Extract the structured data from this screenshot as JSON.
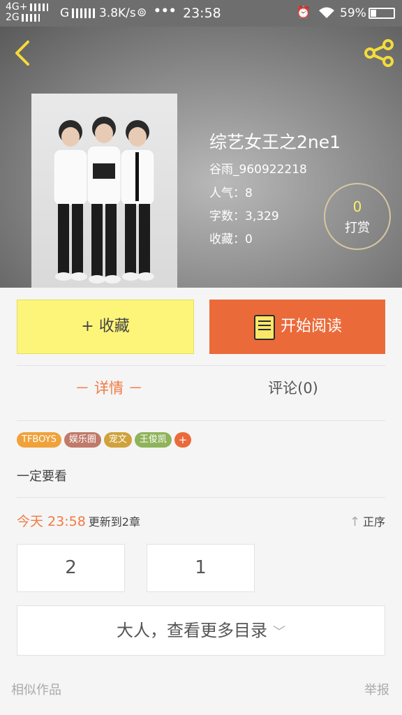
{
  "statusbar": {
    "net1": "4G+",
    "net2": "2G",
    "g": "G",
    "speed": "3.8K/s",
    "dots": "•••",
    "time": "23:58",
    "battery": "59%"
  },
  "book": {
    "title": "综艺女王之2ne1",
    "author": "谷雨_960922218",
    "popularity": "人气：8",
    "wordcount": "字数：3,329",
    "favorites": "收藏：0"
  },
  "tip": {
    "count": "0",
    "label": "打赏"
  },
  "actions": {
    "favorite": "+ 收藏",
    "read": "开始阅读"
  },
  "tabs": {
    "detail": "－ 详情 －",
    "comments": "评论(0)"
  },
  "tags": [
    {
      "label": "TFBOYS",
      "color": "#f0a23a"
    },
    {
      "label": "娱乐圈",
      "color": "#c07a6a"
    },
    {
      "label": "宠文",
      "color": "#cfa23c"
    },
    {
      "label": "王俊凯",
      "color": "#8fb35a"
    },
    {
      "label": "+",
      "color": "#eb6a3a"
    }
  ],
  "description": "一定要看",
  "update": {
    "time": "今天 23:58",
    "text": "更新到2章"
  },
  "sort_label": "正序",
  "chapters": [
    "2",
    "1"
  ],
  "more_label": "大人，查看更多目录",
  "footer": {
    "similar": "相似作品",
    "report": "举报"
  },
  "colors": {
    "accent": "#eb6a3a",
    "favorite_bg": "#fdf57a"
  }
}
